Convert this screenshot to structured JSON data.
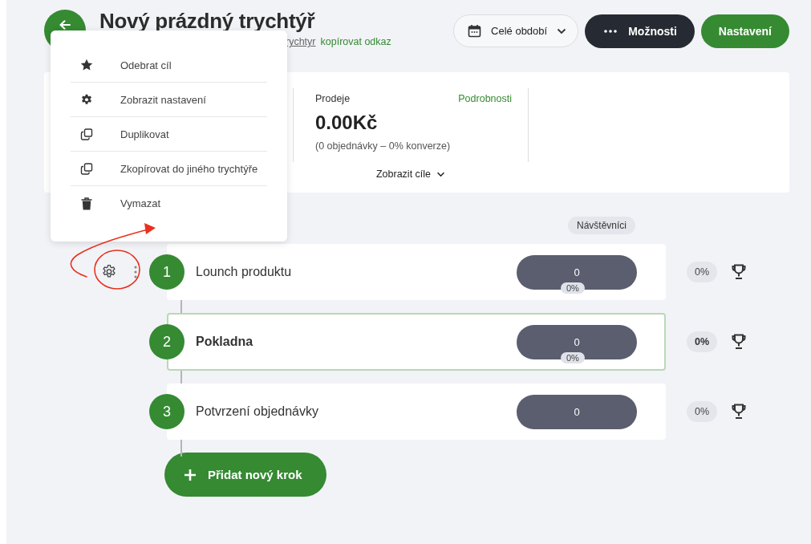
{
  "header": {
    "title": "Nový prázdný trychtýř",
    "link": "rychtyr",
    "copy_link": "kopírovat odkaz",
    "period": "Celé období",
    "options_button": "Možnosti",
    "settings_button": "Nastavení"
  },
  "menu": {
    "items": [
      {
        "label": "Odebrat cíl",
        "kind": "star"
      },
      {
        "label": "Zobrazit nastavení",
        "kind": "gear"
      },
      {
        "label": "Duplikovat",
        "kind": "copy"
      },
      {
        "label": "Zkopírovat do jiného trychtýře",
        "kind": "copy"
      },
      {
        "label": "Vymazat",
        "kind": "trash"
      }
    ]
  },
  "stats": {
    "label": "Prodeje",
    "details_link": "Podrobnosti",
    "value": "0.00Kč",
    "note": "(0 objednávky – 0% konverze)",
    "toggle": "Zobrazit cíle"
  },
  "visitors_header": "Návštěvníci",
  "steps": [
    {
      "number": "1",
      "name": "Lounch produktu",
      "visitors": "0",
      "conversion": "0%",
      "rate": "0%",
      "selected": false,
      "hovered": true
    },
    {
      "number": "2",
      "name": "Pokladna",
      "visitors": "0",
      "conversion": "0%",
      "rate": "0%",
      "selected": true,
      "hovered": false
    },
    {
      "number": "3",
      "name": "Potvrzení objednávky",
      "visitors": "0",
      "rate": "0%",
      "selected": false,
      "hovered": false
    }
  ],
  "add_step": "Přidat nový krok"
}
